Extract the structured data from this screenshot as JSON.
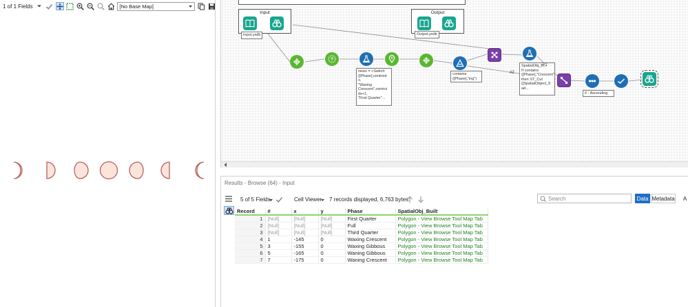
{
  "map_pane": {
    "fields_label": "1 of 1 Fields",
    "basemap_value": "[No Base Map]",
    "icons": [
      "dropdown-arrow-icon",
      "checkmark-icon",
      "pan-icon",
      "select-rectangle-icon",
      "zoom-in-icon",
      "zoom-out-icon",
      "zoom-selection-icon",
      "home-icon",
      "copy-icon",
      "save-icon"
    ]
  },
  "canvas": {
    "containers": [
      {
        "title": "Input",
        "tool_label": "Input.yxdb"
      },
      {
        "title": "Output",
        "tool_label": "Output.yxdb"
      }
    ],
    "annotations": {
      "formula": "newx = <Switch\n([Phase],centroid\nx,\n\"Waxing\nCrescent\",centroi\ndx+1,\n\"First Quarter\"...",
      "filter": "contains\n([Phase],\"ing\")",
      "spatial": "SpatialObj_B...\nIf contains\n([Phase],\"Crescent\")\nthen ST_Cut\n([SpatialObject_9\nad...",
      "sort": "# - Ascending"
    },
    "port_labels": [
      "#1",
      "#2"
    ]
  },
  "results": {
    "title": "Results - Browse (64) - Input",
    "fields_label": "5 of 5 Fields",
    "viewer_label": "Cell Viewer",
    "record_info": "7 records displayed, 6,763 bytes",
    "search_placeholder": "Search",
    "tab_data": "Data",
    "tab_metadata": "Metadata",
    "tab_extra": "A",
    "columns": [
      "Record",
      "#",
      "x",
      "y",
      "Phase",
      "SpatialObj_Built"
    ],
    "rows": [
      [
        "1",
        "[Null]",
        "[Null]",
        "[Null]",
        "First Quarter",
        "Polygon - View Browse Tool Map Tab"
      ],
      [
        "2",
        "[Null]",
        "[Null]",
        "[Null]",
        "Full",
        "Polygon - View Browse Tool Map Tab"
      ],
      [
        "3",
        "[Null]",
        "[Null]",
        "[Null]",
        "Third Quarter",
        "Polygon - View Browse Tool Map Tab"
      ],
      [
        "4",
        "1",
        "-145",
        "0",
        "Waxing Crescent",
        "Polygon - View Browse Tool Map Tab"
      ],
      [
        "5",
        "3",
        "-155",
        "0",
        "Waxing Gibbous",
        "Polygon - View Browse Tool Map Tab"
      ],
      [
        "6",
        "5",
        "-165",
        "0",
        "Waning Gibbous",
        "Polygon - View Browse Tool Map Tab"
      ],
      [
        "7",
        "7",
        "-175",
        "0",
        "Waning Crescent",
        "Polygon - View Browse Tool Map Tab"
      ]
    ]
  },
  "colors": {
    "moon_fill": "#fbe4dc",
    "moon_stroke": "#b9605a",
    "spatial_text": "#1e7f1e",
    "active_tab": "#1f6fc4",
    "header_underline": "#8fd46d"
  }
}
